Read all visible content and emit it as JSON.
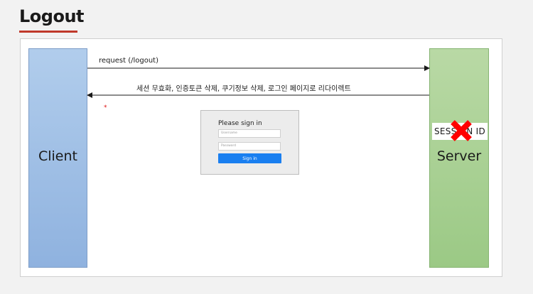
{
  "title": "Logout",
  "client": {
    "label": "Client"
  },
  "server": {
    "label": "Server",
    "session_label": "SESSION ID"
  },
  "arrows": {
    "request": "request (/logout)",
    "response": "세션 무효화, 인증토큰 삭제, 쿠기정보 삭제, 로그인 페이지로 리다이렉트"
  },
  "annotation": "*",
  "login_form": {
    "title": "Please sign in",
    "username_placeholder": "Username",
    "password_placeholder": "Password",
    "button": "Sign in"
  },
  "colors": {
    "accent_underline": "#c0392b",
    "client": "#9dbde5",
    "server": "#a7cf91",
    "cross": "#ff0000",
    "sign_in_button": "#1a7ff0"
  },
  "icons": {
    "invalidated": "cross-icon"
  }
}
